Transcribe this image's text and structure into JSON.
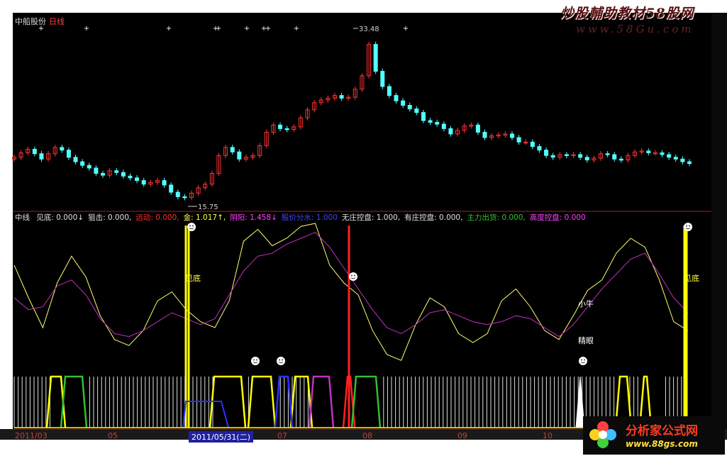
{
  "watermark": {
    "title": "炒股輔助教材58股网",
    "site": "www.58Gu.com"
  },
  "stock": {
    "name": "中船股份",
    "period": "日线"
  },
  "price_annotations": {
    "high": "33.48",
    "low": "15.75"
  },
  "indicator": {
    "name": "中线",
    "items": [
      {
        "text": "见底: 0.000↓",
        "color": "#e0e0e0"
      },
      {
        "text": "狙击: 0.000,",
        "color": "#e0e0e0"
      },
      {
        "text": "远动: 0.000,",
        "color": "#ff3030"
      },
      {
        "text": "金: 1.017↑,",
        "color": "#ffff40"
      },
      {
        "text": "阴阳: 1.458↓",
        "color": "#ff40ff"
      },
      {
        "text": "股价分水: 1.000",
        "color": "#4040ff"
      },
      {
        "text": "无庄控盘: 1.000,",
        "color": "#e0e0e0"
      },
      {
        "text": "有庄控盘: 0.000,",
        "color": "#e0e0e0"
      },
      {
        "text": "主力出货: 0.000,",
        "color": "#30c030"
      },
      {
        "text": "高度控盘: 0.000",
        "color": "#ff40ff"
      }
    ],
    "signal_labels": {
      "jiandi1": "见底",
      "jiandi2": "见底",
      "xiaoniu": "小牛",
      "jingyan": "精眼"
    }
  },
  "x_axis": {
    "ticks": [
      "2011/03",
      "05",
      "07",
      "08",
      "09",
      "10"
    ],
    "cursor_label": "2011/05/31(二)"
  },
  "logo": {
    "name": "分析家公式网",
    "site": "www.88gs.com"
  },
  "colors": {
    "background": "#000000",
    "up": "#ff3232",
    "down": "#54ffff",
    "ma_fast": "#ffff70",
    "ma_slow": "#c030c0",
    "signal": "#ffff00",
    "alert": "#ff2020"
  },
  "chart_data": [
    {
      "type": "candlestick",
      "title": "中船股份 日线",
      "x": [
        "2011/03",
        "05",
        "07",
        "08",
        "09",
        "10"
      ],
      "close": [
        20.4,
        20.9,
        21.3,
        20.8,
        20.2,
        20.8,
        21.5,
        21.2,
        20.4,
        19.9,
        19.5,
        19.2,
        18.6,
        18.4,
        18.9,
        18.7,
        18.3,
        18.1,
        17.8,
        17.4,
        17.6,
        17.8,
        17.3,
        16.5,
        16.0,
        15.9,
        16.4,
        17.0,
        17.4,
        18.6,
        20.6,
        21.5,
        21.0,
        20.2,
        20.4,
        20.6,
        21.7,
        23.2,
        24.0,
        23.6,
        23.5,
        23.8,
        24.8,
        25.7,
        26.5,
        26.8,
        27.0,
        27.3,
        27.0,
        27.1,
        28.0,
        29.5,
        33.0,
        30.0,
        28.3,
        27.3,
        26.7,
        26.2,
        25.8,
        25.4,
        24.5,
        24.3,
        24.1,
        23.6,
        23.0,
        23.4,
        23.9,
        24.0,
        23.2,
        22.6,
        22.8,
        22.9,
        23.0,
        22.6,
        22.1,
        22.1,
        21.6,
        21.2,
        20.6,
        20.4,
        20.7,
        20.6,
        20.7,
        20.4,
        20.1,
        20.3,
        20.8,
        20.7,
        20.2,
        20.1,
        20.6,
        21.0,
        21.1,
        20.9,
        20.9,
        20.7,
        20.4,
        20.2,
        19.9,
        19.7
      ],
      "high_label": 33.48,
      "low_label": 15.75
    },
    {
      "type": "line",
      "title": "中线",
      "series": [
        {
          "name": "金",
          "values": [
            72,
            50,
            30,
            60,
            78,
            64,
            38,
            22,
            18,
            28,
            48,
            54,
            42,
            34,
            30,
            48,
            88,
            96,
            85,
            90,
            98,
            100,
            72,
            60,
            52,
            28,
            12,
            8,
            32,
            50,
            44,
            26,
            20,
            26,
            48,
            56,
            44,
            28,
            22,
            38,
            55,
            62,
            80,
            90,
            84,
            62,
            34,
            28
          ]
        },
        {
          "name": "阴阳",
          "values": [
            50,
            42,
            44,
            58,
            62,
            52,
            36,
            26,
            24,
            28,
            34,
            40,
            36,
            32,
            36,
            52,
            68,
            78,
            80,
            86,
            90,
            94,
            84,
            70,
            56,
            42,
            30,
            26,
            32,
            40,
            42,
            38,
            34,
            32,
            34,
            38,
            36,
            30,
            24,
            32,
            44,
            56,
            66,
            76,
            80,
            66,
            50,
            40
          ]
        }
      ],
      "ylim": [
        0,
        100
      ]
    }
  ]
}
